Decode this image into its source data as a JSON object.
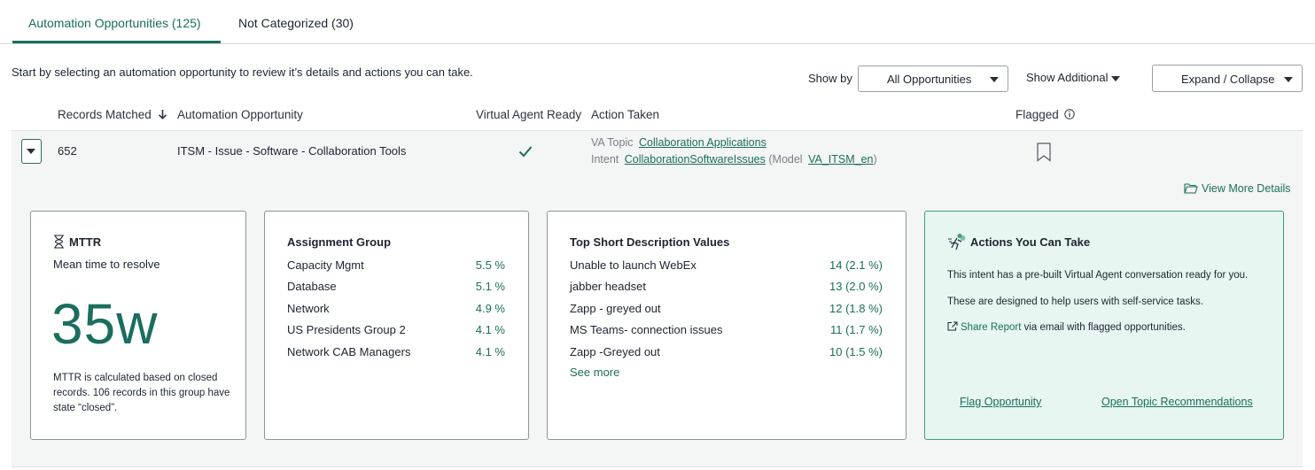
{
  "tabs": [
    {
      "label": "Automation Opportunities (125)",
      "active": true
    },
    {
      "label": "Not Categorized (30)",
      "active": false
    }
  ],
  "intro": "Start by selecting an automation opportunity to review it’s details and actions you can take.",
  "toolbar": {
    "show_by_label": "Show by",
    "show_by_value": "All Opportunities",
    "show_additional_label": "Show Additional",
    "expand_collapse_label": "Expand / Collapse"
  },
  "columns": {
    "records_matched": "Records Matched",
    "sort_icon": "arrow-down-icon",
    "automation_opportunity": "Automation Opportunity",
    "virtual_agent_ready": "Virtual Agent Ready",
    "action_taken": "Action Taken",
    "flagged": "Flagged"
  },
  "row": {
    "records": "652",
    "opportunity": "ITSM - Issue - Software - Collaboration Tools",
    "va_topic_label": "VA Topic",
    "va_topic_link": "Collaboration Applications",
    "intent_label": "Intent",
    "intent_link": "CollaborationSoftwareIssues",
    "model_open": "(Model",
    "model_link": "VA_ITSM_en",
    "model_close": ")"
  },
  "view_more": "View More Details",
  "mttr": {
    "title": "MTTR",
    "subtitle": "Mean time to resolve",
    "value": "35w",
    "note": "MTTR is calculated based on closed records. 106 records in this group have state “closed”."
  },
  "assignment_group": {
    "title": "Assignment Group",
    "items": [
      {
        "name": "Capacity Mgmt",
        "value": "5.5 %"
      },
      {
        "name": "Database",
        "value": "5.1 %"
      },
      {
        "name": "Network",
        "value": "4.9 %"
      },
      {
        "name": "US Presidents Group 2",
        "value": "4.1 %"
      },
      {
        "name": "Network CAB Managers",
        "value": "4.1 %"
      }
    ]
  },
  "short_descriptions": {
    "title": "Top Short Description Values",
    "items": [
      {
        "name": "Unable to launch WebEx",
        "value": "14 (2.1 %)"
      },
      {
        "name": "jabber headset",
        "value": "13 (2.0 %)"
      },
      {
        "name": "Zapp - greyed out",
        "value": "12 (1.8 %)"
      },
      {
        "name": "MS Teams- connection issues",
        "value": "11 (1.7 %)"
      },
      {
        "name": "Zapp -Greyed out",
        "value": "10 (1.5 %)"
      }
    ],
    "see_more": "See more"
  },
  "actions": {
    "title": "Actions You Can Take",
    "line1": "This intent has a pre-built Virtual Agent conversation ready for you.",
    "line2": "These are designed to help users with self-service tasks.",
    "share_link": "Share Report",
    "share_rest": "via email with flagged opportunities.",
    "flag_link": "Flag Opportunity",
    "topic_link": "Open Topic Recommendations"
  },
  "colors": {
    "accent": "#1a6e5c",
    "panel": "#f4f5f5",
    "green_card": "#e7f6f1"
  }
}
